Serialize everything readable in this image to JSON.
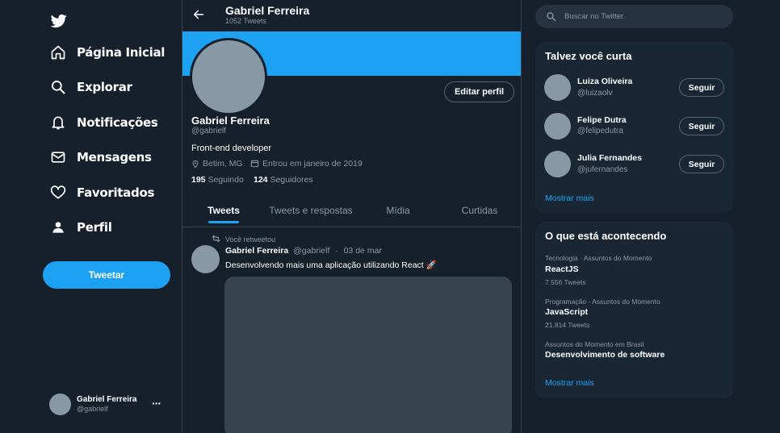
{
  "sidebar": {
    "logo_icon": "twitter-bird-icon",
    "items": [
      {
        "label": "Página Inicial",
        "icon": "home-icon"
      },
      {
        "label": "Explorar",
        "icon": "search-icon"
      },
      {
        "label": "Notificações",
        "icon": "bell-icon"
      },
      {
        "label": "Mensagens",
        "icon": "mail-icon"
      },
      {
        "label": "Favoritados",
        "icon": "heart-icon"
      },
      {
        "label": "Perfil",
        "icon": "person-icon"
      }
    ],
    "tweet_button": "Tweetar",
    "account": {
      "name": "Gabriel Ferreira",
      "handle": "@gabrielf",
      "more": "···"
    }
  },
  "header": {
    "title": "Gabriel Ferreira",
    "subtitle": "1052 Tweets"
  },
  "profile": {
    "edit_button": "Editar perfil",
    "name": "Gabriel Ferreira",
    "handle": "@gabrielf",
    "bio": "Front-end developer",
    "location": "Betim, MG",
    "joined": "Entrou em janeiro de 2019",
    "following_count": "195",
    "following_label": "Seguindo",
    "followers_count": "124",
    "followers_label": "Seguidores",
    "banner_color": "#1da1f2"
  },
  "tabs": [
    "Tweets",
    "Tweets e respostas",
    "Mídia",
    "Curtidas"
  ],
  "tweet": {
    "retweet_note": "Você retweetou",
    "author": "Gabriel Ferreira",
    "handle": "@gabrielf",
    "dot": "·",
    "date": "03 de mar",
    "text": "Desenvolvendo mais uma aplicação utilizando React 🚀"
  },
  "search": {
    "placeholder": "Buscar no Twitter"
  },
  "suggestions": {
    "title": "Talvez você curta",
    "users": [
      {
        "name": "Luiza Oliveira",
        "handle": "@luizaolv",
        "button": "Seguir"
      },
      {
        "name": "Felipe Dutra",
        "handle": "@felipedutra",
        "button": "Seguir"
      },
      {
        "name": "Julia Fernandes",
        "handle": "@jufernandes",
        "button": "Seguir"
      }
    ],
    "show_more": "Mostrar mais"
  },
  "trends": {
    "title": "O que está acontecendo",
    "items": [
      {
        "context": "Tecnologia · Assuntos do Momento",
        "name": "ReactJS",
        "count": "7.556 Tweets"
      },
      {
        "context": "Programação · Assuntos do Momento",
        "name": "JavaScript",
        "count": "21.814 Tweets"
      },
      {
        "context": "Assuntos do Momento em Brasil",
        "name": "Desenvolvimento de software",
        "count": ""
      }
    ],
    "show_more": "Mostrar mais"
  },
  "colors": {
    "accent": "#1da1f2",
    "background": "#15202b",
    "panel": "#192734",
    "muted": "#8899a6",
    "border": "#38444d"
  }
}
